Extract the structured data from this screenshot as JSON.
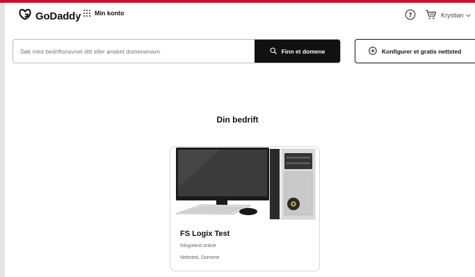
{
  "header": {
    "logo_text": "GoDaddy",
    "account_label": "Min konto",
    "user_name": "Krystian",
    "help_glyph": "?"
  },
  "search": {
    "placeholder": "Søk med bedriftsnavnet ditt eller ønsket domenenavn",
    "value": "",
    "button_label": "Finn et domene"
  },
  "configure_button_label": "Konfigurer et gratis nettsted",
  "section_title": "Din bedrift",
  "card": {
    "name": "FS Logix Test",
    "domain": "fslogixtest.online",
    "tags": "Nettsted, Domene",
    "image": "desktop-computer-photo"
  },
  "colors": {
    "accent_bar": "#c8102e",
    "primary_button": "#111111",
    "border": "#b9b9b9"
  },
  "icons": [
    "godaddy-logo-icon",
    "apps-grid-icon",
    "help-icon",
    "cart-icon",
    "chevron-down-icon",
    "search-icon",
    "plus-circle-icon"
  ]
}
